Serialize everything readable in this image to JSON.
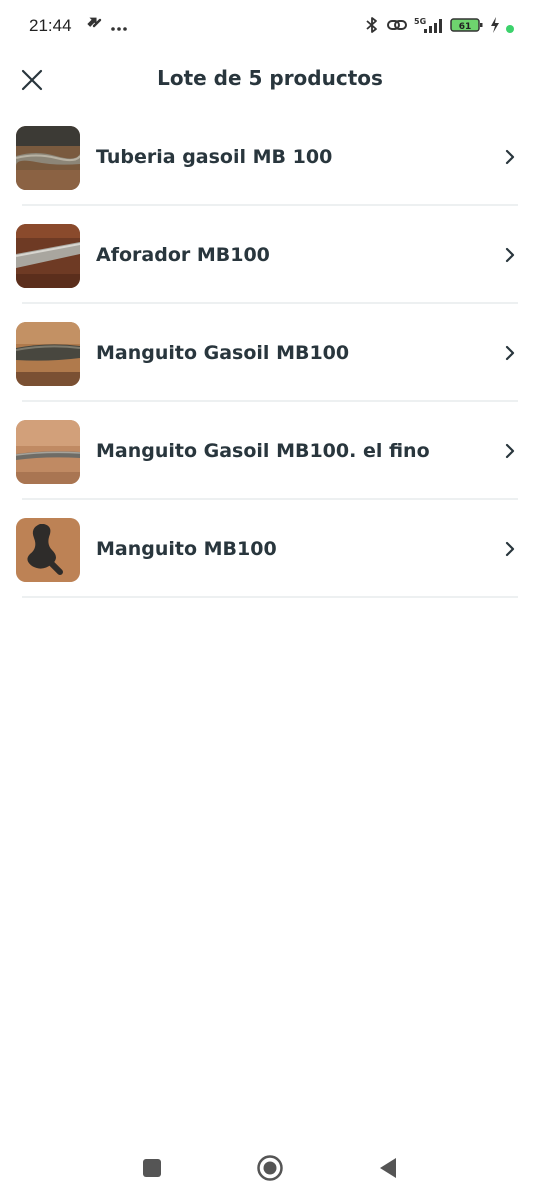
{
  "status_bar": {
    "time": "21:44",
    "left_icons": [
      "notification-app-icon",
      "more-dots-icon"
    ],
    "right_icons": [
      "bluetooth-icon",
      "link-icon",
      "signal-5g-icon",
      "battery-icon",
      "charging-icon",
      "dot-indicator-icon"
    ],
    "network": "5G",
    "battery": "61",
    "accent": "#3cd26c"
  },
  "header": {
    "title": "Lote de 5 productos",
    "close_icon": "close-icon"
  },
  "items": [
    {
      "label": "Tuberia gasoil MB 100"
    },
    {
      "label": "Aforador MB100"
    },
    {
      "label": "Manguito Gasoil MB100"
    },
    {
      "label": "Manguito Gasoil MB100. el fino"
    },
    {
      "label": "Manguito MB100"
    }
  ],
  "nav": {
    "buttons": [
      "recent-apps-icon",
      "home-icon",
      "back-icon"
    ]
  },
  "colors": {
    "text": "#29363d",
    "divider": "#edf0f1",
    "battery_fill": "#6ed46e"
  }
}
